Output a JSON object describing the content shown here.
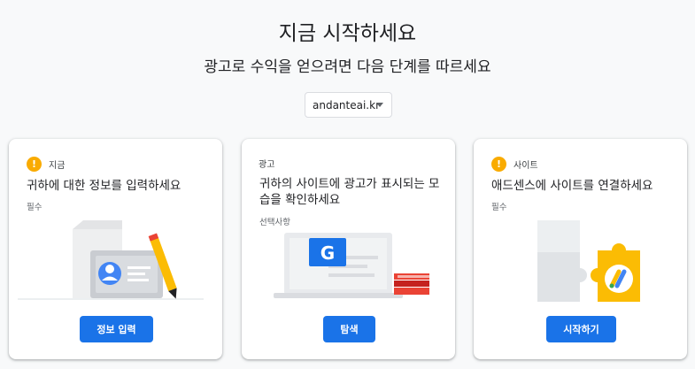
{
  "header": {
    "title": "지금 시작하세요",
    "subtitle": "광고로 수익을 얻으려면 다음 단계를 따르세요"
  },
  "site_select": {
    "value": "andanteai.kr"
  },
  "cards": [
    {
      "tag": "지금",
      "title": "귀하에 대한 정보를 입력하세요",
      "note": "필수",
      "button": "정보 입력",
      "has_warning": true,
      "illustration": "profile-card-pencil"
    },
    {
      "tag": "광고",
      "title": "귀하의 사이트에 광고가 표시되는 모습을 확인하세요",
      "note": "선택사항",
      "button": "탐색",
      "has_warning": false,
      "illustration": "laptop-google-books"
    },
    {
      "tag": "사이트",
      "title": "애드센스에 사이트를 연결하세요",
      "note": "필수",
      "button": "시작하기",
      "has_warning": true,
      "illustration": "puzzle-adsense"
    }
  ],
  "colors": {
    "primary_button": "#1a73e8",
    "warning": "#f9ab00",
    "background": "#f8f9fa"
  }
}
